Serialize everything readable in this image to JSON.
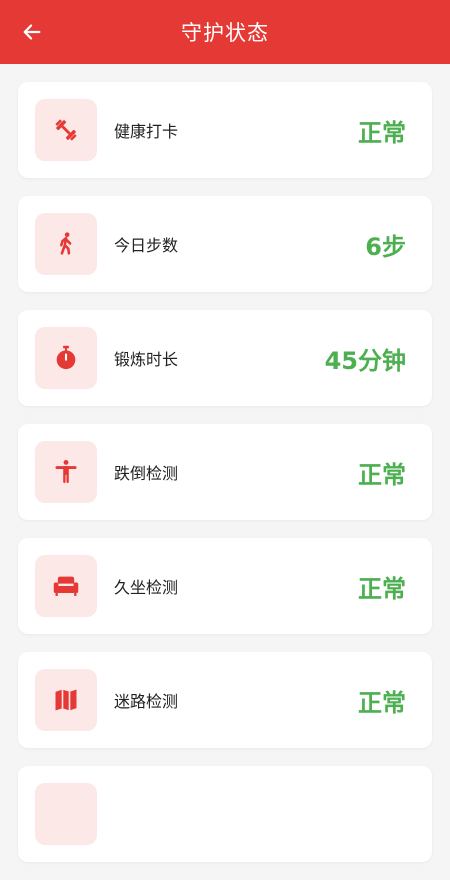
{
  "header": {
    "title": "守护状态",
    "back_icon": "arrow-left-icon"
  },
  "colors": {
    "primary": "#e53935",
    "icon_bg": "#fde8e8",
    "status_ok": "#4caf50",
    "status_warn": "#f5a623"
  },
  "items": [
    {
      "icon": "dumbbell-icon",
      "label": "健康打卡",
      "value": "正常"
    },
    {
      "icon": "walking-person-icon",
      "label": "今日步数",
      "value": "6步"
    },
    {
      "icon": "stopwatch-icon",
      "label": "锻炼时长",
      "value": "45分钟"
    },
    {
      "icon": "person-arms-out-icon",
      "label": "跌倒检测",
      "value": "正常"
    },
    {
      "icon": "sofa-icon",
      "label": "久坐检测",
      "value": "正常"
    },
    {
      "icon": "map-icon",
      "label": "迷路检测",
      "value": "正常"
    }
  ]
}
